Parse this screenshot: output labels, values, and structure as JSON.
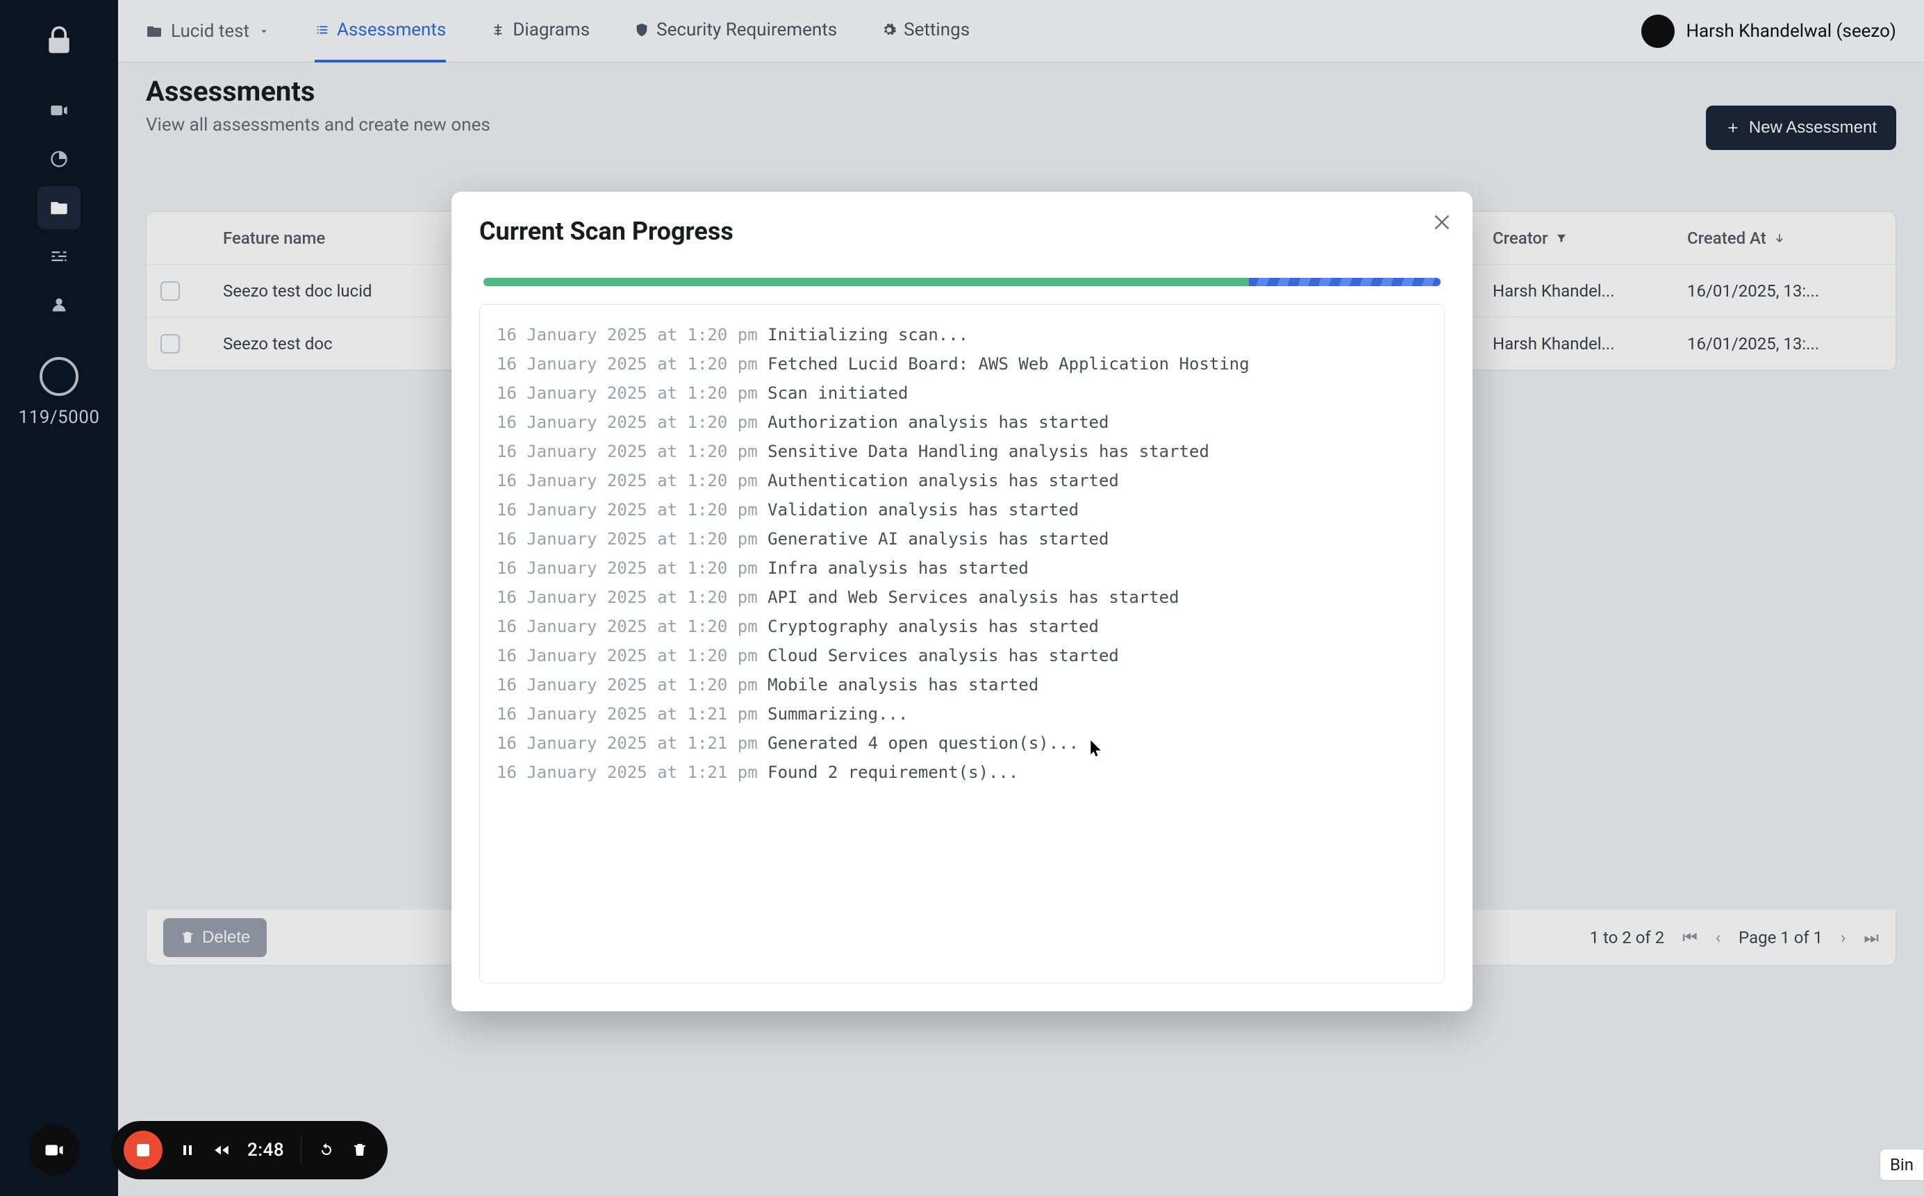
{
  "sidebar": {
    "counter": "119/5000"
  },
  "topbar": {
    "project": "Lucid test",
    "tabs": {
      "assessments": "Assessments",
      "diagrams": "Diagrams",
      "security_requirements": "Security Requirements",
      "settings": "Settings"
    },
    "user": "Harsh Khandelwal (seezo)"
  },
  "page": {
    "title": "Assessments",
    "subtitle": "View all assessments and create new ones",
    "new_button": "New Assessment"
  },
  "table": {
    "headers": {
      "feature": "Feature name",
      "creator": "Creator",
      "created_at": "Created At"
    },
    "rows": [
      {
        "feature": "Seezo test doc lucid",
        "creator": "Harsh Khandel...",
        "created": "16/01/2025, 13:..."
      },
      {
        "feature": "Seezo test doc",
        "creator": "Harsh Khandel...",
        "created": "16/01/2025, 13:..."
      }
    ],
    "footer": {
      "delete": "Delete",
      "range": "1 to 2 of 2",
      "page": "Page 1 of 1"
    }
  },
  "modal": {
    "title": "Current Scan Progress",
    "progress": {
      "done_pct": 80,
      "active_pct": 20
    },
    "log": [
      {
        "ts": "16 January 2025 at 1:20 pm",
        "msg": "Initializing scan..."
      },
      {
        "ts": "16 January 2025 at 1:20 pm",
        "msg": "Fetched Lucid Board: AWS Web Application Hosting"
      },
      {
        "ts": "16 January 2025 at 1:20 pm",
        "msg": "Scan initiated"
      },
      {
        "ts": "16 January 2025 at 1:20 pm",
        "msg": "Authorization analysis has started"
      },
      {
        "ts": "16 January 2025 at 1:20 pm",
        "msg": "Sensitive Data Handling analysis has started"
      },
      {
        "ts": "16 January 2025 at 1:20 pm",
        "msg": "Authentication analysis has started"
      },
      {
        "ts": "16 January 2025 at 1:20 pm",
        "msg": "Validation analysis has started"
      },
      {
        "ts": "16 January 2025 at 1:20 pm",
        "msg": "Generative AI analysis has started"
      },
      {
        "ts": "16 January 2025 at 1:20 pm",
        "msg": "Infra analysis has started"
      },
      {
        "ts": "16 January 2025 at 1:20 pm",
        "msg": "API and Web Services analysis has started"
      },
      {
        "ts": "16 January 2025 at 1:20 pm",
        "msg": "Cryptography analysis has started"
      },
      {
        "ts": "16 January 2025 at 1:20 pm",
        "msg": "Cloud Services analysis has started"
      },
      {
        "ts": "16 January 2025 at 1:20 pm",
        "msg": "Mobile analysis has started"
      },
      {
        "ts": "16 January 2025 at 1:21 pm",
        "msg": "Summarizing..."
      },
      {
        "ts": "16 January 2025 at 1:21 pm",
        "msg": "Generated 4 open question(s)..."
      },
      {
        "ts": "16 January 2025 at 1:21 pm",
        "msg": "Found 2 requirement(s)..."
      }
    ]
  },
  "recorder": {
    "time": "2:48"
  },
  "tooltip": {
    "bin": "Bin"
  }
}
